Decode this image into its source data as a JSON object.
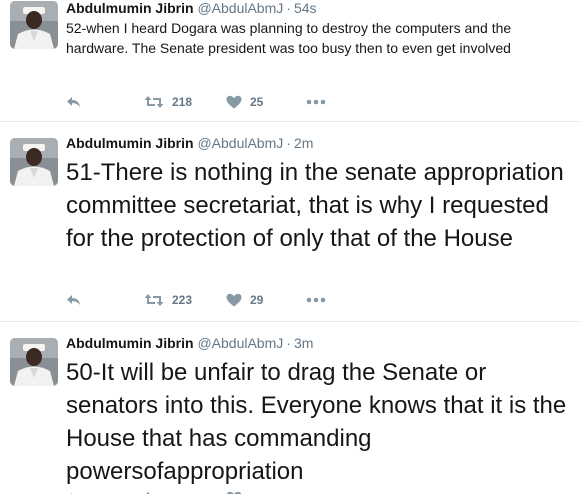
{
  "colors": {
    "text": "#14171a",
    "muted": "#657786",
    "divider": "#e1e8ed"
  },
  "tweets": [
    {
      "author_name": "Abdulmumin Jibrin",
      "handle": "@AbdulAbmJ",
      "separator": "·",
      "time": "54s",
      "text": "52-when I heard Dogara was planning to destroy the computers and the hardware. The Senate president was too busy then to even get involved",
      "retweets": "218",
      "likes": "25",
      "icons": [
        "reply-icon",
        "retweet-icon",
        "heart-icon",
        "more-icon"
      ]
    },
    {
      "author_name": "Abdulmumin Jibrin",
      "handle": "@AbdulAbmJ",
      "separator": "·",
      "time": "2m",
      "text": "51-There is nothing in the senate appropriation committee secretariat, that is why I requested for the protection of only that of the House",
      "retweets": "223",
      "likes": "29",
      "icons": [
        "reply-icon",
        "retweet-icon",
        "heart-icon",
        "more-icon"
      ]
    },
    {
      "author_name": "Abdulmumin Jibrin",
      "handle": "@AbdulAbmJ",
      "separator": "·",
      "time": "3m",
      "text": "50-It will be unfair to drag the Senate or senators into this. Everyone knows that it is the House that has commanding powersofappropriation",
      "retweets": "",
      "likes": "",
      "icons": [
        "reply-icon",
        "retweet-icon",
        "heart-icon",
        "more-icon"
      ]
    }
  ]
}
